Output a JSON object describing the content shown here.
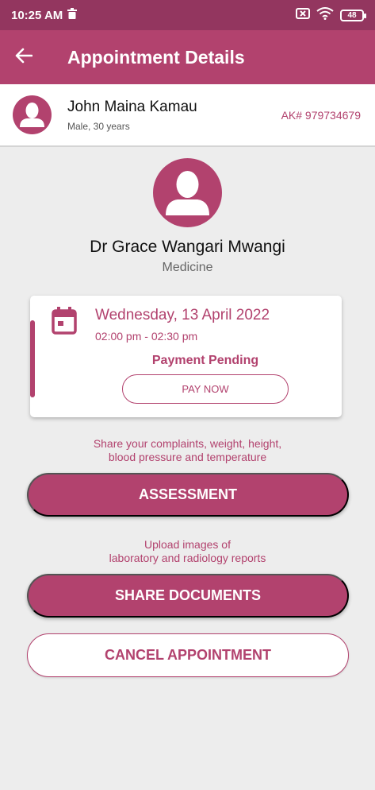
{
  "status_bar": {
    "time": "10:25 AM",
    "battery": "48",
    "icons": [
      "trash-icon",
      "sim-off-icon",
      "wifi-icon",
      "battery-icon"
    ]
  },
  "app_bar": {
    "title": "Appointment Details",
    "back_icon": "arrow-left-icon"
  },
  "patient": {
    "name": "John Maina Kamau",
    "meta": "Male, 30 years",
    "id": "AK# 979734679"
  },
  "doctor": {
    "name": "Dr Grace Wangari Mwangi",
    "department": "Medicine"
  },
  "appointment": {
    "date": "Wednesday, 13 April 2022",
    "time": "02:00 pm - 02:30 pm",
    "payment_status": "Payment Pending",
    "pay_button": "PAY NOW"
  },
  "assessment": {
    "hint_line1": "Share your complaints, weight, height,",
    "hint_line2": "blood pressure and temperature",
    "button": "ASSESSMENT"
  },
  "documents": {
    "hint_line1": "Upload images of",
    "hint_line2": "laboratory and radiology reports",
    "button": "SHARE DOCUMENTS"
  },
  "cancel": {
    "button": "CANCEL APPOINTMENT"
  },
  "colors": {
    "status_bar": "#93365f",
    "primary": "#b2426e",
    "background": "#ededed"
  }
}
